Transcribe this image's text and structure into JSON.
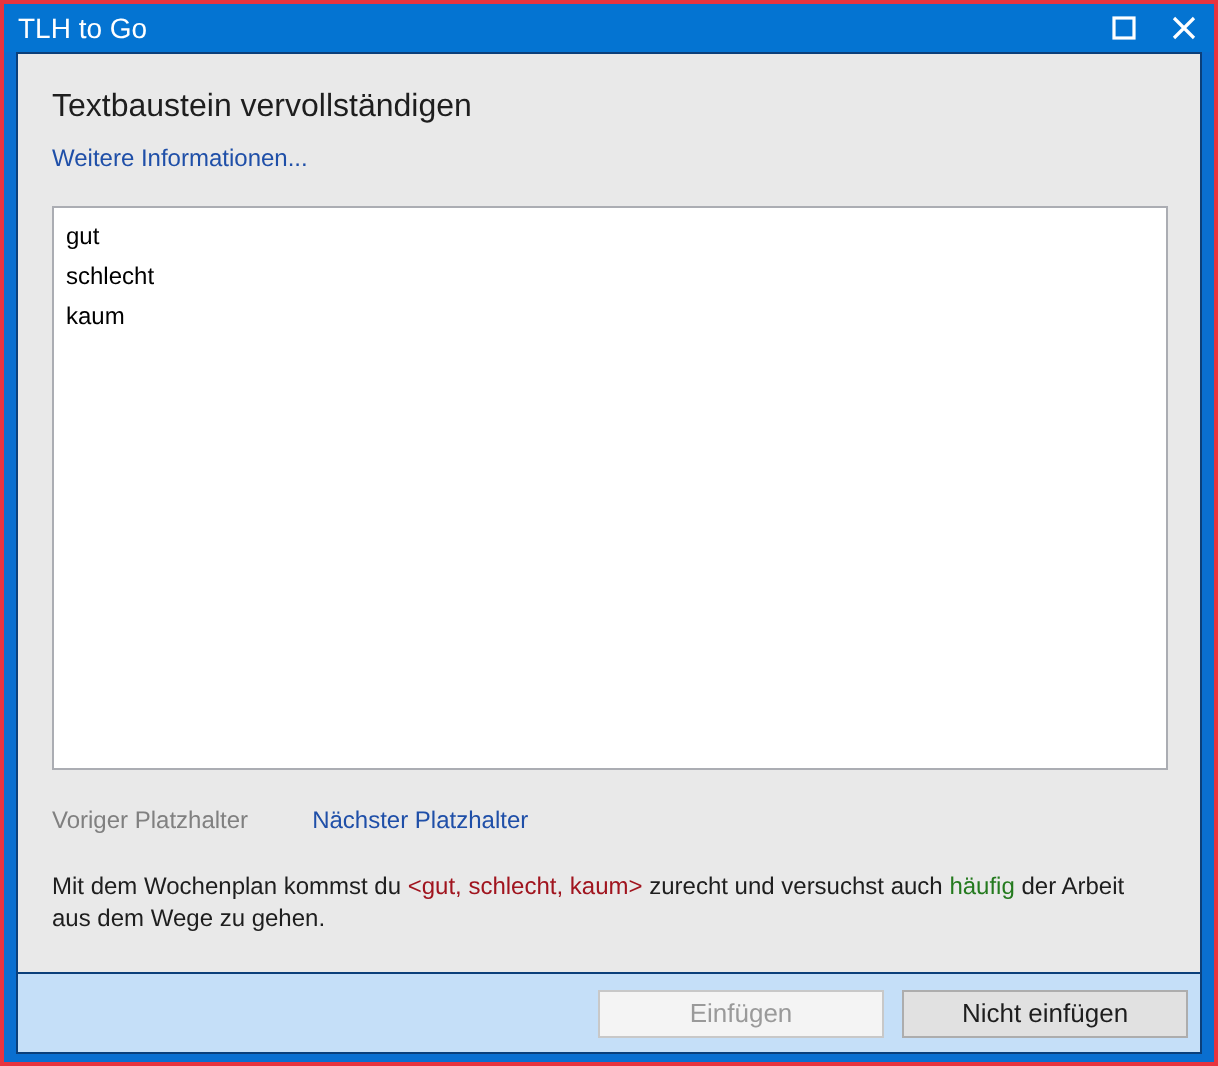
{
  "window": {
    "title": "TLH to Go"
  },
  "heading": "Textbaustein vervollständigen",
  "info_link": "Weitere Informationen...",
  "options": [
    {
      "label": "gut",
      "selected": false
    },
    {
      "label": "schlecht",
      "selected": false
    },
    {
      "label": "kaum",
      "selected": false
    }
  ],
  "nav": [
    {
      "label": "Voriger Platzhalter",
      "disabled": true
    },
    {
      "label": "Nächster Platzhalter",
      "disabled": false
    }
  ],
  "preview": [
    {
      "kind": "plain",
      "text": "Mit dem Wochenplan kommst du "
    },
    {
      "kind": "placeholder",
      "text": "<gut, schlecht, kaum>"
    },
    {
      "kind": "plain",
      "text": " zurecht und versuchst auch "
    },
    {
      "kind": "filled",
      "text": "häufig"
    },
    {
      "kind": "plain",
      "text": " der Arbeit aus dem Wege zu gehen."
    }
  ],
  "buttons": [
    {
      "label": "Einfügen",
      "disabled": true
    },
    {
      "label": "Nicht einfügen",
      "disabled": false
    }
  ]
}
